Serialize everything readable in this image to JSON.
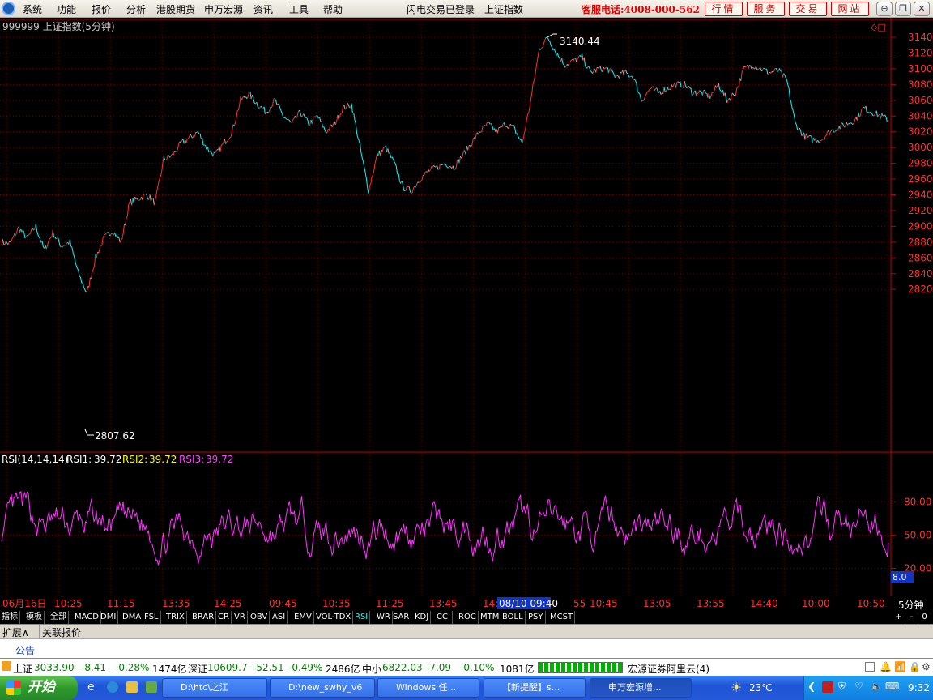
{
  "menu": {
    "items": [
      "系统",
      "功能",
      "报价",
      "分析",
      "港股期货",
      "申万宏源",
      "资讯",
      "工具",
      "帮助"
    ],
    "status": [
      "闪电交易已登录",
      "上证指数"
    ],
    "hotline": "客服电话:4008-000-562",
    "buttons": [
      "行情",
      "服务",
      "交易",
      "网站"
    ],
    "window_buttons": [
      "⊖",
      "❐",
      "✕"
    ]
  },
  "chart": {
    "title": "999999 上证指数(5分钟)",
    "high_label": "3140.44",
    "low_label": "2807.62",
    "price_axis": [
      "3140",
      "3120",
      "3100",
      "3080",
      "3060",
      "3040",
      "3020",
      "3000",
      "2980",
      "2960",
      "2940",
      "2920",
      "2900",
      "2880",
      "2860",
      "2840",
      "2820"
    ],
    "rsi_title": "RSI(14,14,14)",
    "rsi_values": [
      {
        "label": "RSI1:",
        "value": "39.72",
        "color": "#ffffff"
      },
      {
        "label": "RSI2:",
        "value": "39.72",
        "color": "#ffff00"
      },
      {
        "label": "RSI3:",
        "value": "39.72",
        "color": "#ff44ff"
      }
    ],
    "rsi_axis": [
      "80.00",
      "50.00",
      "20.00"
    ],
    "rsi_current": "8.0",
    "time_axis": [
      "06月16日",
      "10:25",
      "11:15",
      "13:35",
      "14:25",
      "09:45",
      "10:35",
      "11:25",
      "13:45",
      "14:",
      "08/10 09:40",
      "55",
      "10:45",
      "13:05",
      "13:55",
      "14:40",
      "10:00",
      "10:50"
    ],
    "period": "5分钟",
    "colors": {
      "up": "#ff3030",
      "down": "#00ffff",
      "rsi": "#ff33ff",
      "grid": "#6b0000",
      "axis": "#c00000"
    }
  },
  "chart_data": {
    "type": "line",
    "title": "999999 上证指数(5分钟)",
    "series": [
      {
        "name": "上证指数",
        "values": [
          2880,
          2878,
          2898,
          2885,
          2900,
          2870,
          2892,
          2875,
          2880,
          2840,
          2815,
          2860,
          2885,
          2895,
          2880,
          2930,
          2935,
          2940,
          2930,
          2985,
          2990,
          3005,
          3012,
          3020,
          3000,
          2990,
          3005,
          3020,
          3060,
          3068,
          3055,
          3045,
          3060,
          3040,
          3030,
          3045,
          3030,
          3040,
          3020,
          3030,
          3050,
          3055,
          3000,
          2945,
          2990,
          3000,
          2980,
          2950,
          2945,
          2960,
          2970,
          2975,
          2980,
          2975,
          2990,
          3005,
          3020,
          3030,
          3020,
          3030,
          3025,
          3005,
          3060,
          3125,
          3140,
          3120,
          3105,
          3110,
          3115,
          3095,
          3100,
          3100,
          3090,
          3095,
          3090,
          3060,
          3075,
          3070,
          3075,
          3080,
          3080,
          3070,
          3070,
          3065,
          3080,
          3060,
          3070,
          3100,
          3105,
          3100,
          3095,
          3098,
          3085,
          3030,
          3015,
          3010,
          3010,
          3020,
          3025,
          3030,
          3035,
          3050,
          3045,
          3040,
          3035
        ]
      }
    ],
    "ylim": [
      2807.62,
      3140.44
    ],
    "y_ticks": [
      2820,
      2840,
      2860,
      2880,
      2900,
      2920,
      2940,
      2960,
      2980,
      3000,
      3020,
      3040,
      3060,
      3080,
      3100,
      3120,
      3140
    ],
    "annotations": [
      "3140.44",
      "2807.62"
    ],
    "rsi": {
      "name": "RSI",
      "ylim": [
        0,
        100
      ],
      "ticks": [
        20,
        50,
        80
      ],
      "last": 39.72
    }
  },
  "indicator_tabs": [
    "指标",
    "模板",
    "全部",
    "MACD",
    "DMI",
    "DMA",
    "FSL",
    "TRIX",
    "BRAR",
    "CR",
    "VR",
    "OBV",
    "ASI",
    "EMV",
    "VOL-TDX",
    "RSI",
    "WR",
    "SAR",
    "KDJ",
    "CCI",
    "ROC",
    "MTM",
    "BOLL",
    "PSY",
    "MCST"
  ],
  "active_tab": "RSI",
  "tab_controls": [
    "+",
    "-",
    "0"
  ],
  "extension": [
    "扩展∧",
    "关联报价"
  ],
  "notice": "公告",
  "ticker": [
    {
      "name": "上证",
      "price": "3033.90",
      "chg": "-8.41",
      "pct": "-0.28%",
      "vol": "1474亿"
    },
    {
      "name": "深证",
      "price": "10609.7",
      "chg": "-52.51",
      "pct": "-0.49%",
      "vol": "2486亿"
    },
    {
      "name": "中小",
      "price": "6822.03",
      "chg": "-7.09",
      "pct": "-0.10%",
      "vol": "1081亿"
    }
  ],
  "broker": "宏源证券阿里云(4)",
  "taskbar": {
    "start": "开始",
    "items": [
      "D:\\htc\\之江",
      "D:\\new_swhy_v6",
      "Windows 任...",
      "【新提醒】s...",
      "申万宏源增..."
    ],
    "weather": "23℃",
    "time": "9:32"
  }
}
